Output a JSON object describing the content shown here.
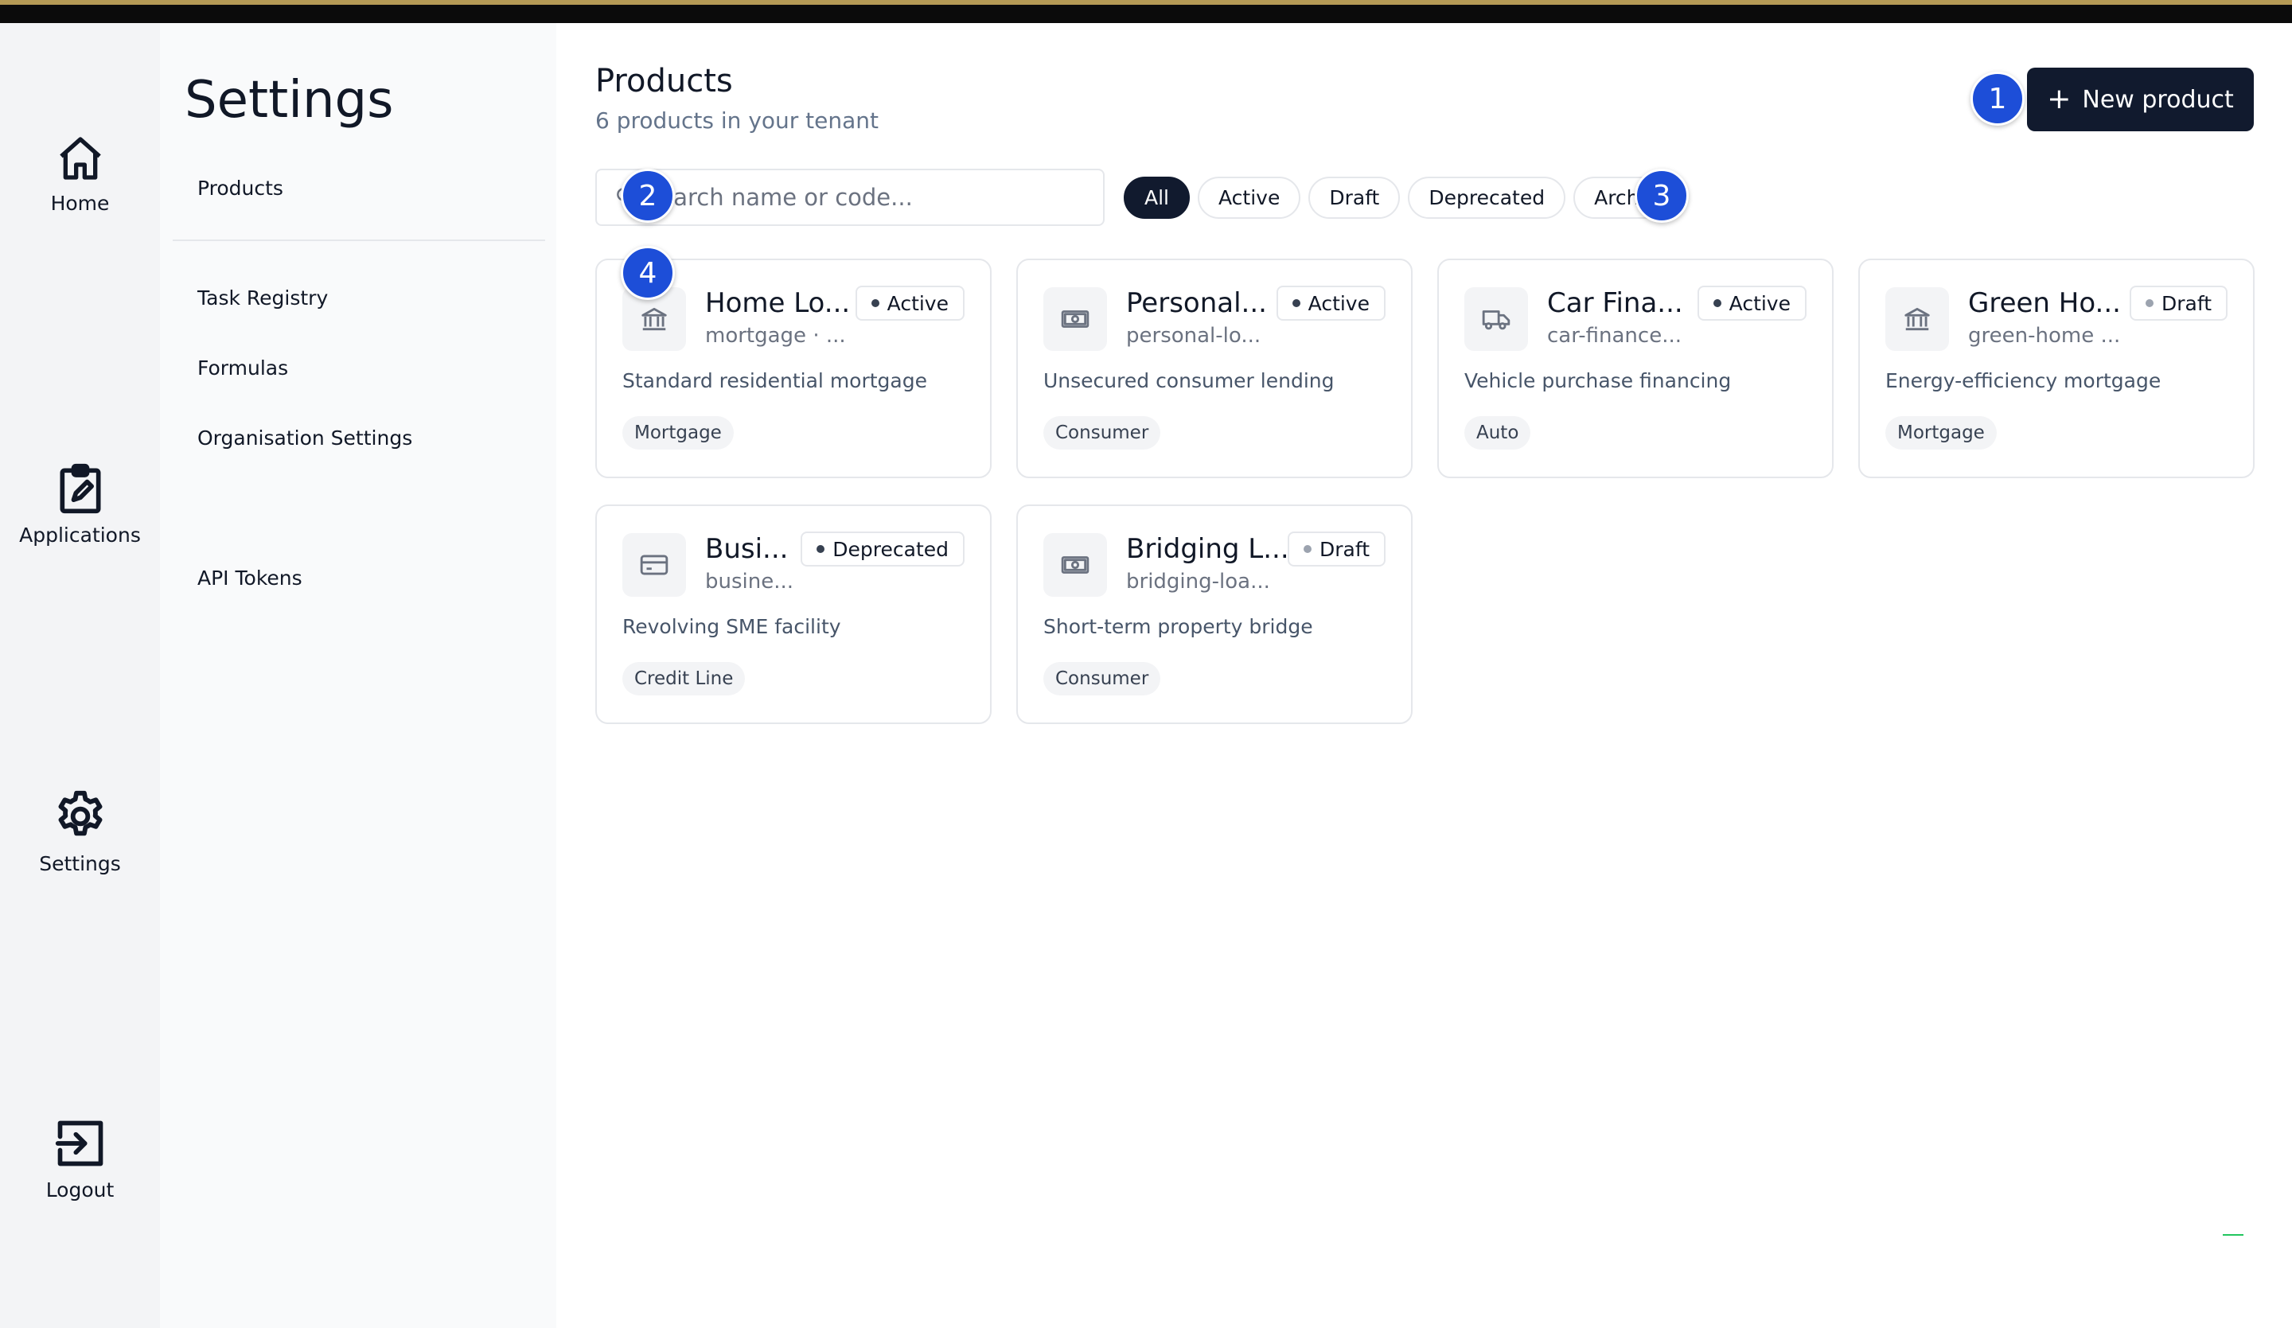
{
  "rail": {
    "items": [
      {
        "label": "Home",
        "icon": "home-icon"
      },
      {
        "label": "Applications",
        "icon": "clipboard-edit-icon"
      },
      {
        "label": "Settings",
        "icon": "gear-icon"
      },
      {
        "label": "Logout",
        "icon": "logout-icon"
      }
    ]
  },
  "settings_nav": {
    "title": "Settings",
    "items": [
      {
        "label": "Products"
      },
      {
        "label": "Task Registry"
      },
      {
        "label": "Formulas"
      },
      {
        "label": "Organisation Settings"
      },
      {
        "label": "API Tokens"
      }
    ]
  },
  "main": {
    "title": "Products",
    "subtitle": "6 products in your tenant",
    "new_button_label": "New product",
    "search_placeholder": "Search name or code...",
    "filters": [
      {
        "label": "All",
        "selected": true
      },
      {
        "label": "Active",
        "selected": false
      },
      {
        "label": "Draft",
        "selected": false
      },
      {
        "label": "Deprecated",
        "selected": false
      },
      {
        "label": "Archiv",
        "selected": false
      }
    ],
    "products": [
      {
        "name": "Home Lo...",
        "code": "mortgage · ...",
        "status": "Active",
        "description": "Standard residential mortgage",
        "tag": "Mortgage",
        "icon": "bank-icon"
      },
      {
        "name": "Personal...",
        "code": "personal-lo...",
        "status": "Active",
        "description": "Unsecured consumer lending",
        "tag": "Consumer",
        "icon": "banknote-icon"
      },
      {
        "name": "Car Fina...",
        "code": "car-finance...",
        "status": "Active",
        "description": "Vehicle purchase financing",
        "tag": "Auto",
        "icon": "truck-icon"
      },
      {
        "name": "Green Ho...",
        "code": "green-home ...",
        "status": "Draft",
        "description": "Energy-efficiency mortgage",
        "tag": "Mortgage",
        "icon": "bank-icon"
      },
      {
        "name": "Busi...",
        "code": "busine...",
        "status": "Deprecated",
        "description": "Revolving SME facility",
        "tag": "Credit Line",
        "icon": "credit-card-icon"
      },
      {
        "name": "Bridging L...",
        "code": "bridging-loa...",
        "status": "Draft",
        "description": "Short-term property bridge",
        "tag": "Consumer",
        "icon": "banknote-icon"
      }
    ]
  },
  "markers": [
    "1",
    "2",
    "3",
    "4"
  ],
  "colors": {
    "primary_dark": "#111a2e",
    "marker_blue": "#1d4ed8",
    "muted_text": "#64748b",
    "top_accent": "#b59a55"
  }
}
